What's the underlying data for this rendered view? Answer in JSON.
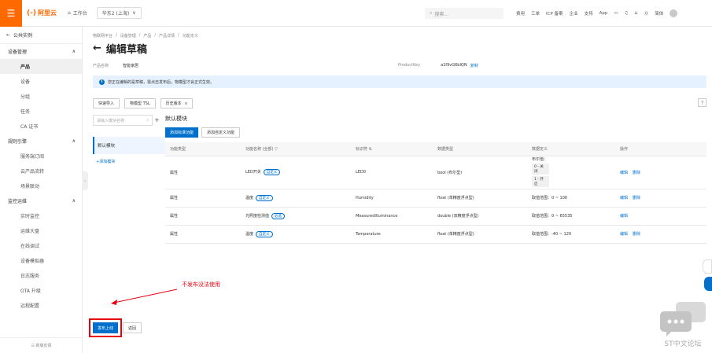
{
  "topbar": {
    "logo_mark": "(-)",
    "logo_text": "阿里云",
    "workbench": "工作台",
    "region": "华东2 (上海)",
    "search_placeholder": "搜索...",
    "links": [
      "费用",
      "工单",
      "ICP 备案",
      "企业",
      "支持",
      "App"
    ],
    "lang": "简体"
  },
  "sidebar": {
    "back": "公共实例",
    "groups": [
      {
        "label": "设备管理",
        "items": [
          {
            "label": "产品",
            "active": true
          },
          {
            "label": "设备"
          },
          {
            "label": "分组"
          },
          {
            "label": "任务"
          },
          {
            "label": "CA 证书"
          }
        ]
      },
      {
        "label": "规则引擎",
        "items": [
          {
            "label": "服务端订阅"
          },
          {
            "label": "云产品流转"
          },
          {
            "label": "场景联动"
          }
        ]
      },
      {
        "label": "监控运维",
        "items": [
          {
            "label": "实时监控"
          },
          {
            "label": "运维大盘"
          },
          {
            "label": "在线调试"
          },
          {
            "label": "设备模拟器"
          },
          {
            "label": "日志服务"
          },
          {
            "label": "OTA 升级"
          },
          {
            "label": "远程配置"
          }
        ]
      }
    ],
    "bottom": "新版反馈"
  },
  "main": {
    "breadcrumb": [
      "物联网平台",
      "/",
      "设备管理",
      "/",
      "产品",
      "/",
      "产品详情",
      "/",
      "功能定义"
    ],
    "title": "编辑草稿",
    "product_name_label": "产品名称",
    "product_name": "智能家居",
    "productkey_label": "ProductKey",
    "productkey": "a1f9vG6bIQN",
    "copy_label": "复制",
    "alert": "您正在编辑的是草稿，需点击发布后，物模型才会正式生效。",
    "buttons": [
      "快速导入",
      "物模型 TSL",
      "历史版本"
    ],
    "module_search_placeholder": "请输入模块名称",
    "module_active": "默认模块",
    "module_add": "+添加模块",
    "section_title": "默认模块",
    "tab_primary": "添加标准功能",
    "tab_default": "添加自定义功能",
    "table": {
      "headers": [
        "功能类型",
        "功能名称 (全部)",
        "标识符",
        "数据类型",
        "数据定义",
        "操作"
      ],
      "rows": [
        {
          "type": "属性",
          "name": "LED开关",
          "tag": "自定义",
          "id": "LED0",
          "dtype": "bool (布尔型)",
          "def_title": "布尔值：",
          "def_enum": [
            "0 - 关闭",
            "1 - 开启"
          ],
          "ops": [
            "编辑",
            "删除"
          ]
        },
        {
          "type": "属性",
          "name": "温度",
          "tag": "自定义",
          "id": "Humidity",
          "dtype": "float (单精度浮点型)",
          "def": "取值范围：0 ~ 100",
          "ops": [
            "编辑",
            "删除"
          ]
        },
        {
          "type": "属性",
          "name": "光照度检测值",
          "tag": "必选",
          "id": "MeasuredIlluminance",
          "dtype": "double (双精度浮点型)",
          "def": "取值范围：0 ~ 65535",
          "ops": [
            "编辑"
          ]
        },
        {
          "type": "属性",
          "name": "温度",
          "tag": "自定义",
          "id": "Temperature",
          "dtype": "float (单精度浮点型)",
          "def": "取值范围：-40 ~ 120",
          "ops": [
            "编辑",
            "删除"
          ]
        }
      ]
    },
    "annotation": "不发布没法使用",
    "publish_btn": "发布上线",
    "back_btn": "返回"
  },
  "watermark": "ST中文论坛",
  "colors": {
    "brand": "#ff6a00",
    "primary": "#0070cc",
    "annotation": "#e60012"
  }
}
